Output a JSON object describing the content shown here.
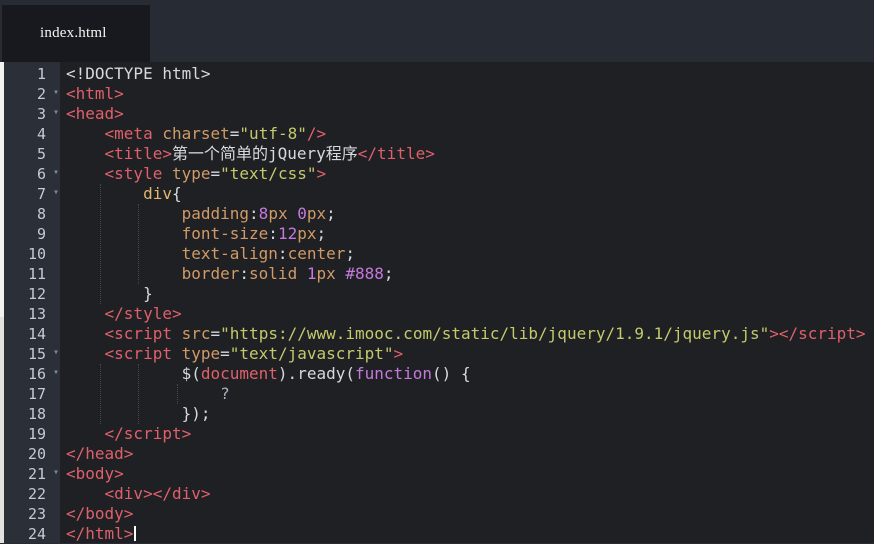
{
  "tab_bar": {
    "active_tab": {
      "title": "index.html"
    }
  },
  "editor": {
    "fold_icon": "▾",
    "colors": {
      "header_bg": "#262b34",
      "tab_bg": "#17191e",
      "tab_text": "#f5f5f3",
      "code_bg": "#1e2024",
      "gutter_bg": "#2b2f38",
      "line_number": "#c5cad3",
      "fold_arrow": "#7b8692",
      "tag": "#e0606a",
      "attr": "#d19a66",
      "string": "#c5c96b",
      "plain": "#d6d9de",
      "number": "#c678dd",
      "keyword": "#c678dd",
      "selector": "#e2b86b",
      "property": "#d19a66",
      "dim": "#a9b0ba",
      "guide": "#424752",
      "scrollbar_track": "#e3e2df",
      "scrollbar_thumb": "#f3f2ef",
      "cursor": "#ffffff"
    },
    "lines": [
      {
        "num": 1,
        "fold": false,
        "indent": 0,
        "tokens": [
          [
            "plain",
            "<!DOCTYPE html>"
          ]
        ]
      },
      {
        "num": 2,
        "fold": true,
        "indent": 0,
        "tokens": [
          [
            "tag",
            "<html>"
          ]
        ]
      },
      {
        "num": 3,
        "fold": true,
        "indent": 0,
        "tokens": [
          [
            "tag",
            "<head>"
          ]
        ]
      },
      {
        "num": 4,
        "fold": false,
        "indent": 4,
        "tokens": [
          [
            "tag",
            "<meta"
          ],
          [
            "plain",
            " "
          ],
          [
            "attr",
            "charset"
          ],
          [
            "plain",
            "="
          ],
          [
            "string",
            "\"utf-8\""
          ],
          [
            "tag",
            "/>"
          ]
        ]
      },
      {
        "num": 5,
        "fold": false,
        "indent": 4,
        "tokens": [
          [
            "tag",
            "<title>"
          ],
          [
            "text",
            "第一个简单的jQuery程序"
          ],
          [
            "tag",
            "</title>"
          ]
        ]
      },
      {
        "num": 6,
        "fold": true,
        "indent": 4,
        "tokens": [
          [
            "tag",
            "<style"
          ],
          [
            "plain",
            " "
          ],
          [
            "attr",
            "type"
          ],
          [
            "plain",
            "="
          ],
          [
            "string",
            "\"text/css\""
          ],
          [
            "tag",
            ">"
          ]
        ]
      },
      {
        "num": 7,
        "fold": true,
        "indent": 8,
        "tokens": [
          [
            "selector",
            "div"
          ],
          [
            "plain",
            "{"
          ]
        ]
      },
      {
        "num": 8,
        "fold": false,
        "indent": 12,
        "tokens": [
          [
            "property",
            "padding"
          ],
          [
            "plain",
            ":"
          ],
          [
            "number",
            "8"
          ],
          [
            "property",
            "px"
          ],
          [
            "plain",
            " "
          ],
          [
            "number",
            "0"
          ],
          [
            "property",
            "px"
          ],
          [
            "plain",
            ";"
          ]
        ]
      },
      {
        "num": 9,
        "fold": false,
        "indent": 12,
        "tokens": [
          [
            "property",
            "font-size"
          ],
          [
            "plain",
            ":"
          ],
          [
            "number",
            "12"
          ],
          [
            "property",
            "px"
          ],
          [
            "plain",
            ";"
          ]
        ]
      },
      {
        "num": 10,
        "fold": false,
        "indent": 12,
        "tokens": [
          [
            "property",
            "text-align"
          ],
          [
            "plain",
            ":"
          ],
          [
            "property",
            "center"
          ],
          [
            "plain",
            ";"
          ]
        ]
      },
      {
        "num": 11,
        "fold": false,
        "indent": 12,
        "tokens": [
          [
            "property",
            "border"
          ],
          [
            "plain",
            ":"
          ],
          [
            "property",
            "solid"
          ],
          [
            "plain",
            " "
          ],
          [
            "number",
            "1"
          ],
          [
            "property",
            "px"
          ],
          [
            "plain",
            " "
          ],
          [
            "number",
            "#888"
          ],
          [
            "plain",
            ";"
          ]
        ]
      },
      {
        "num": 12,
        "fold": false,
        "indent": 8,
        "tokens": [
          [
            "plain",
            "}"
          ]
        ]
      },
      {
        "num": 13,
        "fold": false,
        "indent": 4,
        "tokens": [
          [
            "tag",
            "</style>"
          ]
        ]
      },
      {
        "num": 14,
        "fold": false,
        "indent": 4,
        "tokens": [
          [
            "tag",
            "<script"
          ],
          [
            "plain",
            " "
          ],
          [
            "attr",
            "src"
          ],
          [
            "plain",
            "="
          ],
          [
            "string",
            "\"https://www.imooc.com/static/lib/jquery/1.9.1/jquery.js\""
          ],
          [
            "tag",
            "></script>"
          ]
        ]
      },
      {
        "num": 15,
        "fold": true,
        "indent": 4,
        "tokens": [
          [
            "tag",
            "<script"
          ],
          [
            "plain",
            " "
          ],
          [
            "attr",
            "type"
          ],
          [
            "plain",
            "="
          ],
          [
            "string",
            "\"text/javascript\""
          ],
          [
            "tag",
            ">"
          ]
        ]
      },
      {
        "num": 16,
        "fold": true,
        "indent": 12,
        "tokens": [
          [
            "plain",
            "$("
          ],
          [
            "tag",
            "document"
          ],
          [
            "plain",
            ").ready("
          ],
          [
            "keyword",
            "function"
          ],
          [
            "plain",
            "() {"
          ]
        ]
      },
      {
        "num": 17,
        "fold": false,
        "indent": 16,
        "tokens": [
          [
            "dim",
            "?"
          ]
        ]
      },
      {
        "num": 18,
        "fold": false,
        "indent": 12,
        "tokens": [
          [
            "plain",
            "});"
          ]
        ]
      },
      {
        "num": 19,
        "fold": false,
        "indent": 4,
        "tokens": [
          [
            "tag",
            "</script>"
          ]
        ]
      },
      {
        "num": 20,
        "fold": false,
        "indent": 0,
        "tokens": [
          [
            "tag",
            "</head>"
          ]
        ]
      },
      {
        "num": 21,
        "fold": true,
        "indent": 0,
        "tokens": [
          [
            "tag",
            "<body>"
          ]
        ]
      },
      {
        "num": 22,
        "fold": false,
        "indent": 4,
        "tokens": [
          [
            "tag",
            "<div></div>"
          ]
        ]
      },
      {
        "num": 23,
        "fold": false,
        "indent": 0,
        "tokens": [
          [
            "tag",
            "</body>"
          ]
        ]
      },
      {
        "num": 24,
        "fold": false,
        "indent": 0,
        "cursor": true,
        "tokens": [
          [
            "tag",
            "</html>"
          ]
        ]
      }
    ],
    "guides": [
      {
        "col": 4,
        "from_line": 7,
        "to_line": 12
      },
      {
        "col": 8,
        "from_line": 8,
        "to_line": 11
      },
      {
        "col": 4,
        "from_line": 16,
        "to_line": 18
      },
      {
        "col": 8,
        "from_line": 16,
        "to_line": 18
      },
      {
        "col": 12,
        "from_line": 17,
        "to_line": 17
      }
    ]
  }
}
